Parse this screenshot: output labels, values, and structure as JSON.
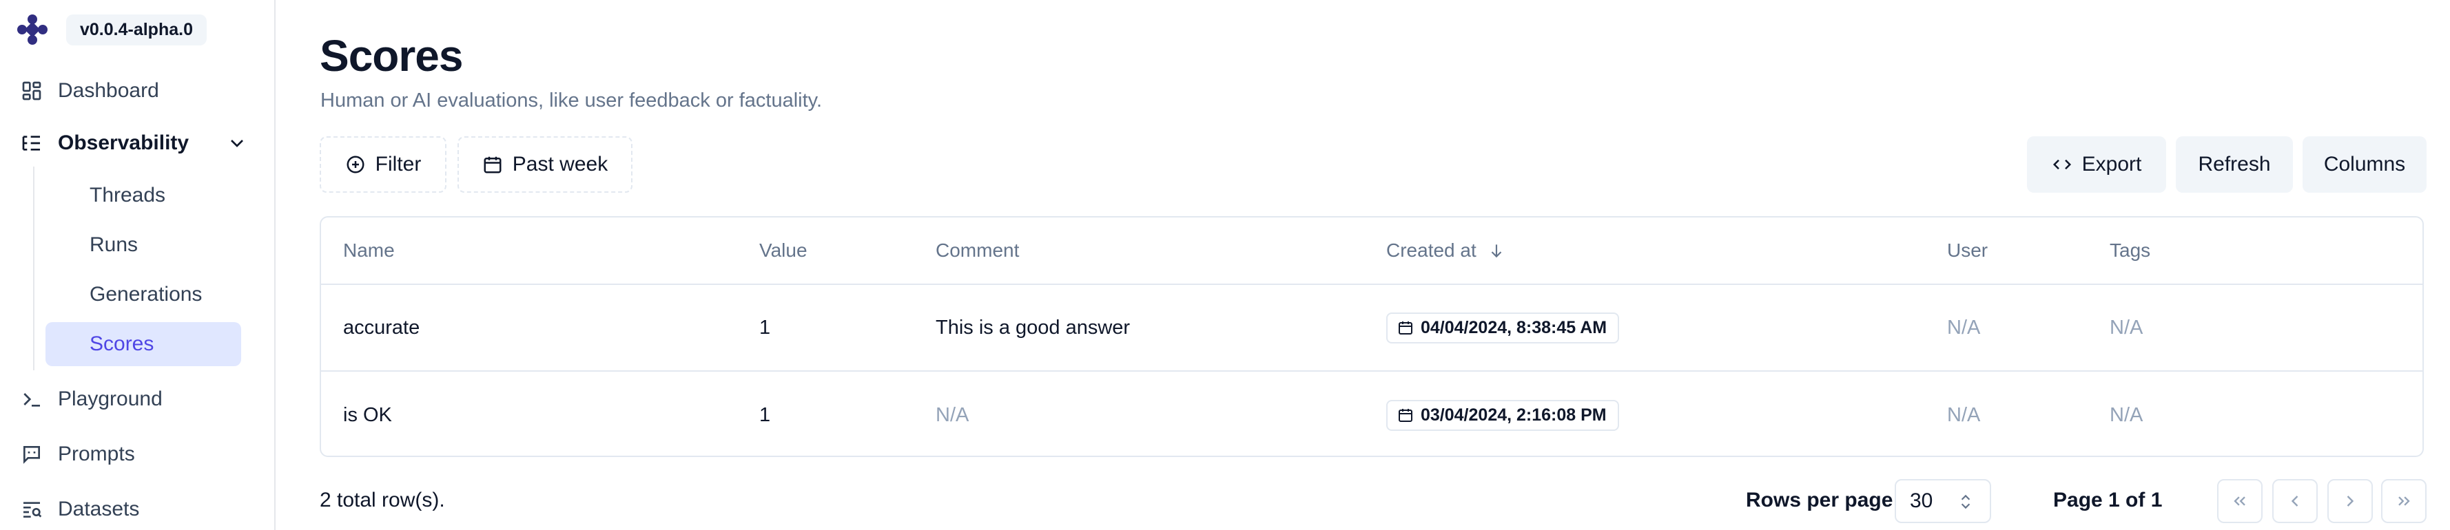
{
  "sidebar": {
    "version": "v0.0.4-alpha.0",
    "items": [
      {
        "label": "Dashboard",
        "icon": "dashboard-icon"
      },
      {
        "label": "Observability",
        "icon": "observability-icon",
        "expanded": true
      },
      {
        "label": "Playground",
        "icon": "terminal-icon"
      },
      {
        "label": "Prompts",
        "icon": "prompts-icon"
      },
      {
        "label": "Datasets",
        "icon": "datasets-icon"
      }
    ],
    "subitems": [
      {
        "label": "Threads"
      },
      {
        "label": "Runs"
      },
      {
        "label": "Generations"
      },
      {
        "label": "Scores",
        "active": true
      }
    ]
  },
  "header": {
    "title": "Scores",
    "subtitle": "Human or AI evaluations, like user feedback or factuality."
  },
  "toolbar": {
    "filter_label": "Filter",
    "date_range_label": "Past week",
    "export_label": "Export",
    "refresh_label": "Refresh",
    "columns_label": "Columns"
  },
  "table": {
    "columns": [
      "Name",
      "Value",
      "Comment",
      "Created at",
      "User",
      "Tags"
    ],
    "rows": [
      {
        "name": "accurate",
        "value": "1",
        "comment": "This is a good answer",
        "created_at": "04/04/2024, 8:38:45 AM",
        "user": "N/A",
        "tags": "N/A"
      },
      {
        "name": "is OK",
        "value": "1",
        "comment": "N/A",
        "created_at": "03/04/2024, 2:16:08 PM",
        "user": "N/A",
        "tags": "N/A"
      }
    ]
  },
  "footer": {
    "total_rows": "2 total row(s).",
    "rows_per_page_label": "Rows per page",
    "rows_per_page_value": "30",
    "page_label": "Page 1 of 1"
  },
  "colors": {
    "accent": "#4f46e5",
    "active_bg": "#e0e7ff",
    "border": "#e2e8f0",
    "muted": "#94a3b8"
  }
}
